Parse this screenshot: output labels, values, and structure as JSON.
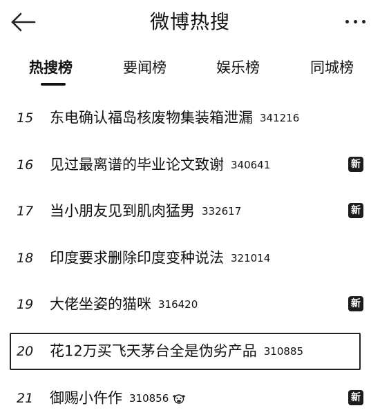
{
  "header": {
    "title": "微博热搜"
  },
  "tabs": [
    {
      "label": "热搜榜",
      "active": true
    },
    {
      "label": "要闻榜",
      "active": false
    },
    {
      "label": "娱乐榜",
      "active": false
    },
    {
      "label": "同城榜",
      "active": false
    }
  ],
  "list": [
    {
      "rank": "15",
      "topic": "东电确认福岛核废物集装箱泄漏",
      "heat": "341216",
      "badge": ""
    },
    {
      "rank": "16",
      "topic": "见过最离谱的毕业论文致谢",
      "heat": "340641",
      "badge": "新"
    },
    {
      "rank": "17",
      "topic": "当小朋友见到肌肉猛男",
      "heat": "332617",
      "badge": "新"
    },
    {
      "rank": "18",
      "topic": "印度要求删除印度变种说法",
      "heat": "321014",
      "badge": ""
    },
    {
      "rank": "19",
      "topic": "大佬坐姿的猫咪",
      "heat": "316420",
      "badge": "新"
    },
    {
      "rank": "20",
      "topic": "花12万买飞天茅台全是伪劣产品",
      "heat": "310885",
      "badge": "",
      "selected": true
    },
    {
      "rank": "21",
      "topic": "御赐小仵作",
      "heat": "310856",
      "badge": "新",
      "emoji": "cow-face-icon"
    }
  ],
  "colors": {
    "text": "#111111",
    "badge_bg": "#1c1c1c",
    "badge_text": "#ffffff",
    "background": "#ffffff"
  }
}
